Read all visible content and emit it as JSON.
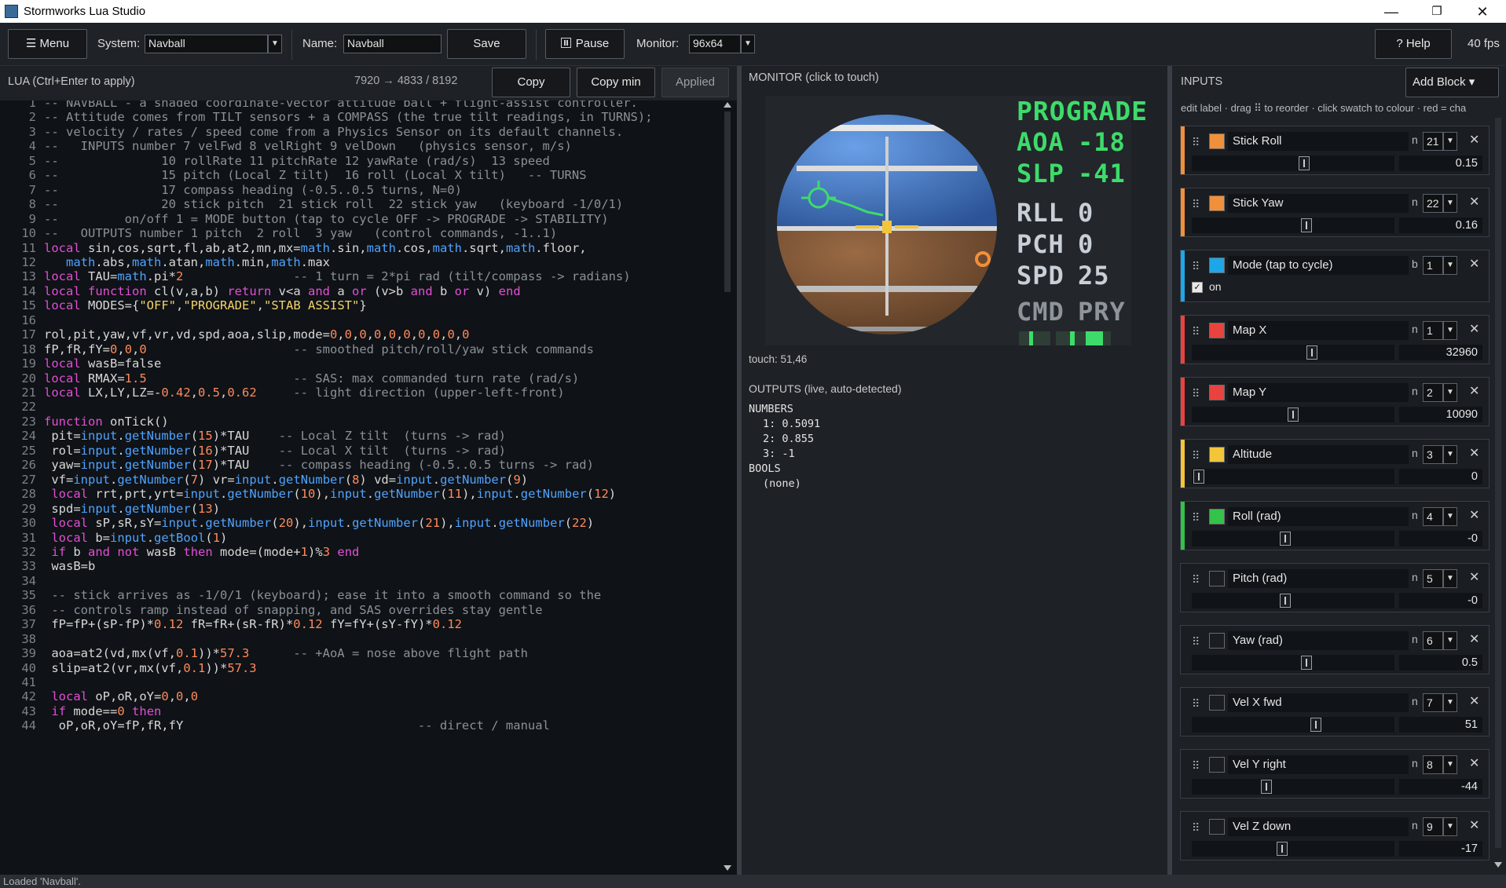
{
  "window": {
    "title": "Stormworks Lua Studio",
    "minimize": "—",
    "restore": "❐",
    "close": "✕"
  },
  "toolbar": {
    "menu_label": "☰ Menu",
    "system_label": "System:",
    "system_value": "Navball",
    "name_label": "Name:",
    "name_value": "Navball",
    "save_label": "Save",
    "pause_label": "Pause",
    "monitor_label": "Monitor:",
    "monitor_value": "96x64",
    "help_label": "? Help",
    "fps": "40 fps"
  },
  "editor": {
    "header": "LUA  (Ctrl+Enter to apply)",
    "stats": "7920 → 4833 / 8192",
    "copy_label": "Copy",
    "copy_min_label": "Copy min",
    "applied_label": "Applied"
  },
  "code_lines": [
    "-- NAVBALL - a shaded coordinate-vector attitude ball + flight-assist controller.",
    "-- Attitude comes from TILT sensors + a COMPASS (the true tilt readings, in TURNS);",
    "-- velocity / rates / speed come from a Physics Sensor on its default channels.",
    "--   INPUTS number 7 velFwd 8 velRight 9 velDown   (physics sensor, m/s)",
    "--              10 rollRate 11 pitchRate 12 yawRate (rad/s)  13 speed",
    "--              15 pitch (Local Z tilt)  16 roll (Local X tilt)   -- TURNS",
    "--              17 compass heading (-0.5..0.5 turns, N=0)",
    "--              20 stick pitch  21 stick roll  22 stick yaw   (keyboard -1/0/1)",
    "--         on/off 1 = MODE button (tap to cycle OFF -> PROGRADE -> STABILITY)",
    "--   OUTPUTS number 1 pitch  2 roll  3 yaw   (control commands, -1..1)",
    "local sin,cos,sqrt,fl,ab,at2,mn,mx=math.sin,math.cos,math.sqrt,math.floor,",
    "   math.abs,math.atan,math.min,math.max",
    "local TAU=math.pi*2               -- 1 turn = 2*pi rad (tilt/compass -> radians)",
    "local function cl(v,a,b) return v<a and a or (v>b and b or v) end",
    "local MODES={\"OFF\",\"PROGRADE\",\"STAB ASSIST\"}",
    "",
    "rol,pit,yaw,vf,vr,vd,spd,aoa,slip,mode=0,0,0,0,0,0,0,0,0,0",
    "fP,fR,fY=0,0,0                    -- smoothed pitch/roll/yaw stick commands",
    "local wasB=false",
    "local RMAX=1.5                    -- SAS: max commanded turn rate (rad/s)",
    "local LX,LY,LZ=-0.42,0.5,0.62     -- light direction (upper-left-front)",
    "",
    "function onTick()",
    " pit=input.getNumber(15)*TAU    -- Local Z tilt  (turns -> rad)",
    " rol=input.getNumber(16)*TAU    -- Local X tilt  (turns -> rad)",
    " yaw=input.getNumber(17)*TAU    -- compass heading (-0.5..0.5 turns -> rad)",
    " vf=input.getNumber(7) vr=input.getNumber(8) vd=input.getNumber(9)",
    " local rrt,prt,yrt=input.getNumber(10),input.getNumber(11),input.getNumber(12)",
    " spd=input.getNumber(13)",
    " local sP,sR,sY=input.getNumber(20),input.getNumber(21),input.getNumber(22)",
    " local b=input.getBool(1)",
    " if b and not wasB then mode=(mode+1)%3 end",
    " wasB=b",
    "",
    " -- stick arrives as -1/0/1 (keyboard); ease it into a smooth command so the",
    " -- controls ramp instead of snapping, and SAS overrides stay gentle",
    " fP=fP+(sP-fP)*0.12 fR=fR+(sR-fR)*0.12 fY=fY+(sY-fY)*0.12",
    "",
    " aoa=at2(vd,mx(vf,0.1))*57.3      -- +AoA = nose above flight path",
    " slip=at2(vr,mx(vf,0.1))*57.3",
    "",
    " local oP,oR,oY=0,0,0",
    " if mode==0 then",
    "  oP,oR,oY=fP,fR,fY                                -- direct / manual"
  ],
  "monitor": {
    "header": "MONITOR  (click to touch)",
    "touch": "touch: 51,46",
    "outputs_header": "OUTPUTS  (live, auto-detected)",
    "numbers_label": "NUMBERS",
    "numbers": [
      "1: 0.5091",
      "2: 0.855",
      "3: -1"
    ],
    "bools_label": "BOOLS",
    "bools": "(none)",
    "hud": {
      "mode": "PROGRADE",
      "aoa_label": "AOA",
      "aoa_value": "-18",
      "slp_label": "SLP",
      "slp_value": "-41",
      "rll_label": "RLL",
      "rll_value": "0",
      "pch_label": "PCH",
      "pch_value": "0",
      "spd_label": "SPD",
      "spd_value": "25",
      "cmd_label": "CMD",
      "cmd_value": "PRY",
      "color_green": "#3ddc6a"
    }
  },
  "inputs": {
    "header": "INPUTS",
    "add_block": "Add Block ▾",
    "hint": "edit label · drag ⠿ to reorder · click swatch to colour · red = cha",
    "blocks": [
      {
        "name": "Stick Roll",
        "type": "n",
        "channel": "21",
        "value": "0.15",
        "color": "#f0903a",
        "level": 0.56
      },
      {
        "name": "Stick Yaw",
        "type": "n",
        "channel": "22",
        "value": "0.16",
        "color": "#f0903a",
        "level": 0.57
      },
      {
        "name": "Mode (tap to cycle)",
        "type": "b",
        "channel": "1",
        "check_label": "on",
        "color": "#1ea7e8"
      },
      {
        "name": "Map X",
        "type": "n",
        "channel": "1",
        "value": "32960",
        "color": "#e8433f",
        "level": 0.6
      },
      {
        "name": "Map Y",
        "type": "n",
        "channel": "2",
        "value": "10090",
        "color": "#e8433f",
        "level": 0.5
      },
      {
        "name": "Altitude",
        "type": "n",
        "channel": "3",
        "value": "0",
        "color": "#f2c53a",
        "level": 0.0
      },
      {
        "name": "Roll (rad)",
        "type": "n",
        "channel": "4",
        "value": "-0",
        "color": "#34c24a",
        "level": 0.46
      },
      {
        "name": "Pitch (rad)",
        "type": "n",
        "channel": "5",
        "value": "-0",
        "color": "#1a1d21",
        "level": 0.46
      },
      {
        "name": "Yaw (rad)",
        "type": "n",
        "channel": "6",
        "value": "0.5",
        "color": "#1a1d21",
        "level": 0.57
      },
      {
        "name": "Vel X fwd",
        "type": "n",
        "channel": "7",
        "value": "51",
        "color": "#1a1d21",
        "level": 0.62
      },
      {
        "name": "Vel Y right",
        "type": "n",
        "channel": "8",
        "value": "-44",
        "color": "#1a1d21",
        "level": 0.36
      },
      {
        "name": "Vel Z down",
        "type": "n",
        "channel": "9",
        "value": "-17",
        "color": "#1a1d21",
        "level": 0.44
      }
    ]
  },
  "status": "Loaded 'Navball'."
}
